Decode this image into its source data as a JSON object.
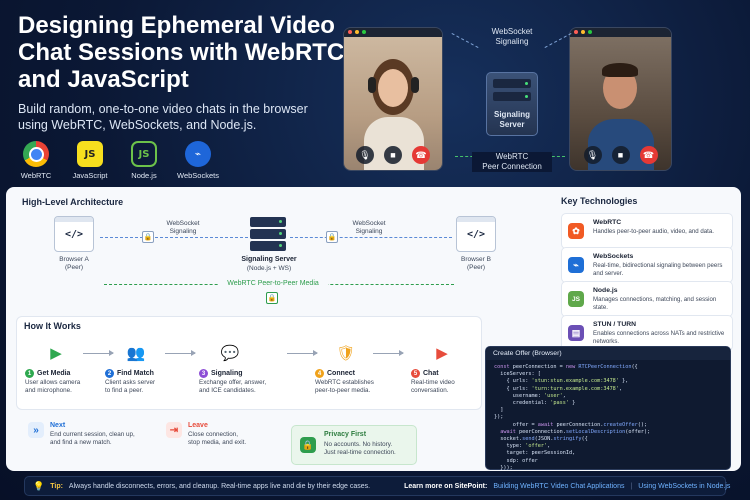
{
  "hero": {
    "title": "Designing Ephemeral Video Chat Sessions with WebRTC and JavaScript",
    "subtitle": "Build random, one-to-one video chats in the browser using WebRTC, WebSockets, and Node.js.",
    "tech": [
      {
        "label": "WebRTC",
        "icon": "webrtc-chrome-icon"
      },
      {
        "label": "JavaScript",
        "icon": "javascript-icon",
        "text": "JS"
      },
      {
        "label": "Node.js",
        "icon": "nodejs-icon",
        "text": "JS"
      },
      {
        "label": "WebSockets",
        "icon": "websockets-icon",
        "text": "⌁"
      }
    ],
    "signaling_label": "WebSocket\nSignaling",
    "server_label": "Signaling\nServer",
    "peer_label": "WebRTC\nPeer Connection"
  },
  "architecture": {
    "title": "High-Level Architecture",
    "browser_a": "Browser A\n(Peer)",
    "browser_b": "Browser B\n(Peer)",
    "browser_glyph": "</>",
    "ws_left": "WebSocket\nSignaling",
    "ws_right": "WebSocket\nSignaling",
    "server_title": "Signaling Server",
    "server_sub": "(Node.js + WS)",
    "p2p_label": "WebRTC Peer-to-Peer Media"
  },
  "how": {
    "title": "How It Works",
    "steps": [
      {
        "num": "1",
        "title": "Get Media",
        "desc": "User allows camera\nand microphone.",
        "color": "#2ea84f",
        "icon": "camera-icon"
      },
      {
        "num": "2",
        "title": "Find Match",
        "desc": "Client asks server\nto find a peer.",
        "color": "#1f6fd6",
        "icon": "users-icon"
      },
      {
        "num": "3",
        "title": "Signaling",
        "desc": "Exchange offer, answer,\nand ICE candidates.",
        "color": "#8e4fd6",
        "icon": "chat-icon"
      },
      {
        "num": "4",
        "title": "Connect",
        "desc": "WebRTC establishes\npeer-to-peer media.",
        "color": "#f0a21b",
        "icon": "shield-icon"
      },
      {
        "num": "5",
        "title": "Chat",
        "desc": "Real-time video\nconversation.",
        "color": "#e74c3c",
        "icon": "video-icon"
      }
    ]
  },
  "actions": {
    "next_title": "Next",
    "next_desc": "End current session, clean up,\nand find a new match.",
    "leave_title": "Leave",
    "leave_desc": "Close connection,\nstop media, and exit.",
    "privacy_title": "Privacy First",
    "privacy_desc": "No accounts. No history.\nJust real-time connection."
  },
  "key_tech": {
    "title": "Key Technologies",
    "items": [
      {
        "name": "WebRTC",
        "desc": "Handles peer-to-peer audio, video, and data.",
        "color": "#f15a24",
        "icon": "webrtc-icon",
        "glyph": "✿"
      },
      {
        "name": "WebSockets",
        "desc": "Real-time, bidirectional signaling between peers and server.",
        "color": "#1f6fd6",
        "icon": "websockets-icon",
        "glyph": "⌁"
      },
      {
        "name": "Node.js",
        "desc": "Manages connections, matching, and session state.",
        "color": "#5fa84a",
        "icon": "nodejs-icon",
        "glyph": "JS"
      },
      {
        "name": "STUN / TURN",
        "desc": "Enables connections across NATs and restrictive networks.",
        "color": "#6b4fb5",
        "icon": "server-icon",
        "glyph": "▤"
      }
    ]
  },
  "code": {
    "title": "Create Offer (Browser)"
  },
  "footer": {
    "tip_label": "Tip:",
    "tip_text": "Always handle disconnects, errors, and cleanup. Real-time apps live and die by their edge cases.",
    "learn_more": "Learn more on SitePoint:",
    "link1": "Building WebRTC Video Chat Applications",
    "separator": "|",
    "link2": "Using WebSockets in Node.js"
  }
}
